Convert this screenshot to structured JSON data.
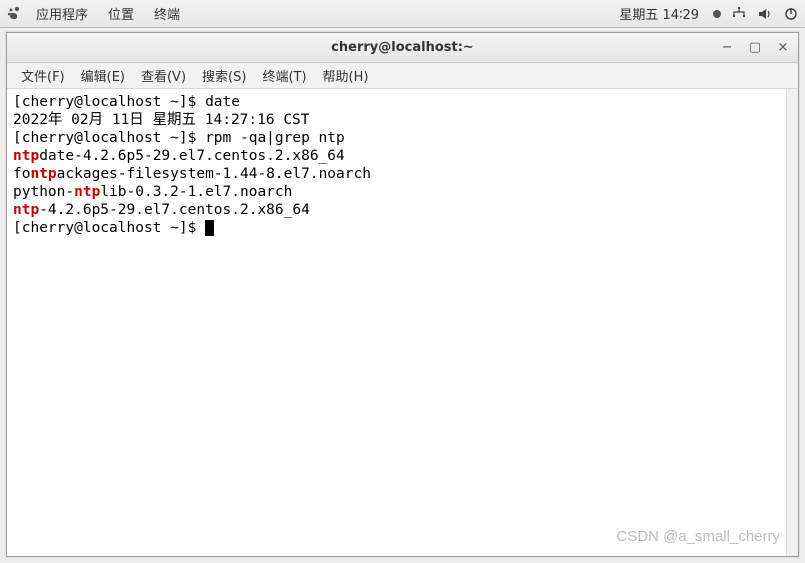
{
  "panel": {
    "apps": "应用程序",
    "places": "位置",
    "terminal": "终端",
    "clock": "星期五 14∶29",
    "icons": {
      "logo": "gnome-logo",
      "network": "network-icon",
      "volume": "volume-icon",
      "power": "power-icon"
    }
  },
  "window": {
    "title": "cherry@localhost:~",
    "controls": {
      "min": "−",
      "max": "▢",
      "close": "×"
    }
  },
  "menubar": {
    "file": "文件(F)",
    "edit": "编辑(E)",
    "view": "查看(V)",
    "search": "搜索(S)",
    "terminal": "终端(T)",
    "help": "帮助(H)"
  },
  "term": {
    "l0a": "[cherry@localhost ~]$ ",
    "l0b": "date",
    "l1": "2022年 02月 11日 星期五 14:27:16 CST",
    "l2a": "[cherry@localhost ~]$ ",
    "l2b": "rpm -qa|grep ntp",
    "l3_pre": "ntp",
    "l3_post": "date-4.2.6p5-29.el7.centos.2.x86_64",
    "l4_pre": "fo",
    "l4_hl": "ntp",
    "l4_post": "ackages-filesystem-1.44-8.el7.noarch",
    "l5_pre": "python-",
    "l5_hl": "ntp",
    "l5_post": "lib-0.3.2-1.el7.noarch",
    "l6_hl": "ntp",
    "l6_post": "-4.2.6p5-29.el7.centos.2.x86_64",
    "l7": "[cherry@localhost ~]$ "
  },
  "watermark": "CSDN @a_small_cherry"
}
